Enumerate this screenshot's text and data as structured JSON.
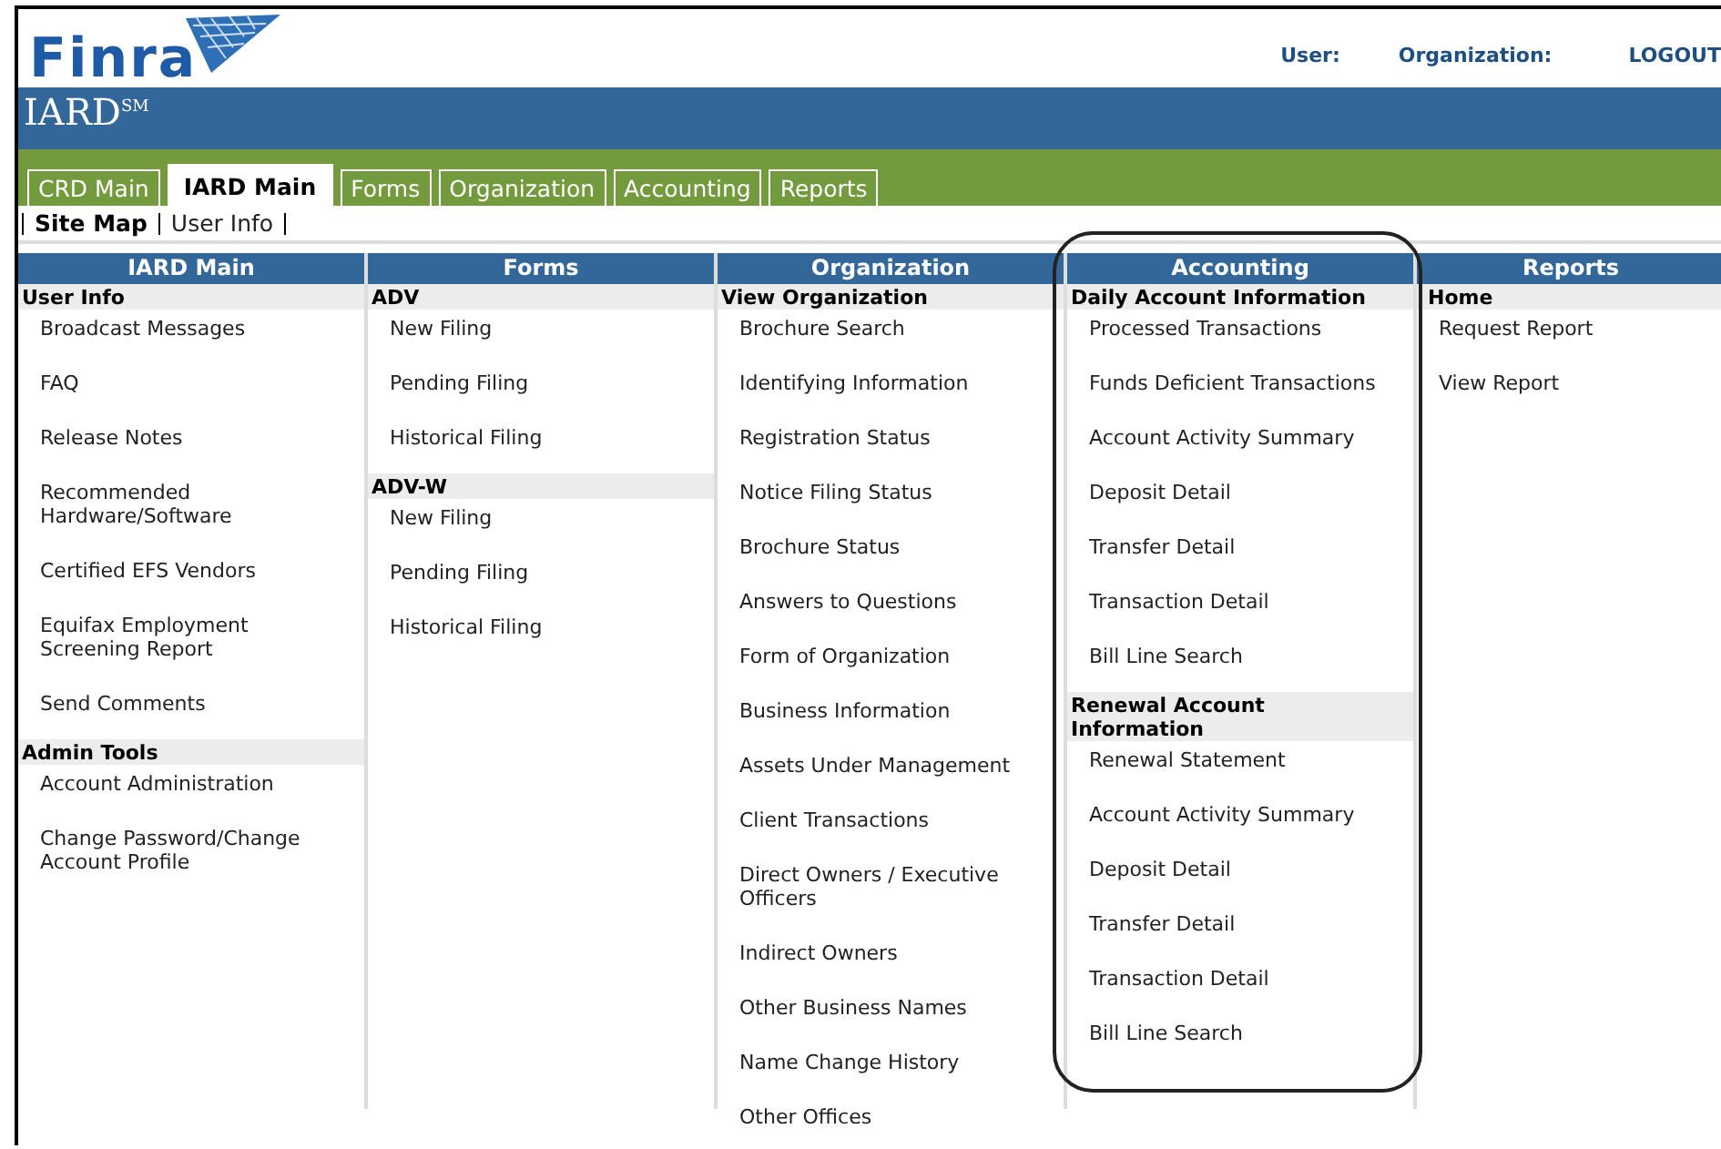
{
  "logo": {
    "text": "Finra"
  },
  "user_bar": [
    {
      "label": "User:",
      "kind": "label"
    },
    {
      "label": "Organization:",
      "kind": "label"
    },
    {
      "label": "LOGOUT",
      "kind": "link"
    }
  ],
  "banner": {
    "title": "IARD$^{SM}$"
  },
  "tabs": [
    {
      "label": "CRD Main",
      "selected": false
    },
    {
      "label": "IARD Main",
      "selected": true
    },
    {
      "label": "Forms",
      "selected": false
    },
    {
      "label": "Organization",
      "selected": false
    },
    {
      "label": "Accounting",
      "selected": false
    },
    {
      "label": "Reports",
      "selected": false
    }
  ],
  "subnav": [
    {
      "label": "Site Map",
      "selected": true
    },
    {
      "label": "User Info",
      "selected": false
    }
  ],
  "columns": [
    {
      "title": "IARD Main",
      "highlighted": false,
      "sections": [
        {
          "heading": "User Info",
          "items": [
            "Broadcast Messages",
            "FAQ",
            "Release Notes",
            "Recommended Hardware/Software",
            "Certified EFS Vendors",
            "Equifax Employment Screening Report",
            "Send Comments"
          ]
        },
        {
          "heading": "Admin Tools",
          "items": [
            "Account Administration",
            "Change Password/Change Account Profile"
          ]
        }
      ]
    },
    {
      "title": "Forms",
      "highlighted": false,
      "sections": [
        {
          "heading": "ADV",
          "items": [
            "New Filing",
            "Pending Filing",
            "Historical Filing"
          ]
        },
        {
          "heading": "ADV-W",
          "items": [
            "New Filing",
            "Pending Filing",
            "Historical Filing"
          ]
        }
      ]
    },
    {
      "title": "Organization",
      "highlighted": false,
      "sections": [
        {
          "heading": "View Organization",
          "items": [
            "Brochure Search",
            "Identifying Information",
            "Registration Status",
            "Notice Filing Status",
            "Brochure Status",
            "Answers to Questions",
            "Form of Organization",
            "Business Information",
            "Assets Under Management",
            "Client Transactions",
            "Direct Owners / Executive Officers",
            "Indirect Owners",
            "Other Business Names",
            "Name Change History",
            "Other Offices"
          ]
        }
      ]
    },
    {
      "title": "Accounting",
      "highlighted": true,
      "sections": [
        {
          "heading": "Daily Account Information",
          "items": [
            "Processed Transactions",
            "Funds Deficient Transactions",
            "Account Activity Summary",
            "Deposit Detail",
            "Transfer Detail",
            "Transaction Detail",
            "Bill Line Search"
          ]
        },
        {
          "heading": "Renewal Account Information",
          "items": [
            "Renewal Statement",
            "Account Activity Summary",
            "Deposit Detail",
            "Transfer Detail",
            "Transaction Detail",
            "Bill Line Search"
          ]
        }
      ]
    },
    {
      "title": "Reports",
      "highlighted": false,
      "sections": [
        {
          "heading": "Home",
          "items": [
            "Request Report",
            "View Report"
          ]
        }
      ]
    }
  ]
}
